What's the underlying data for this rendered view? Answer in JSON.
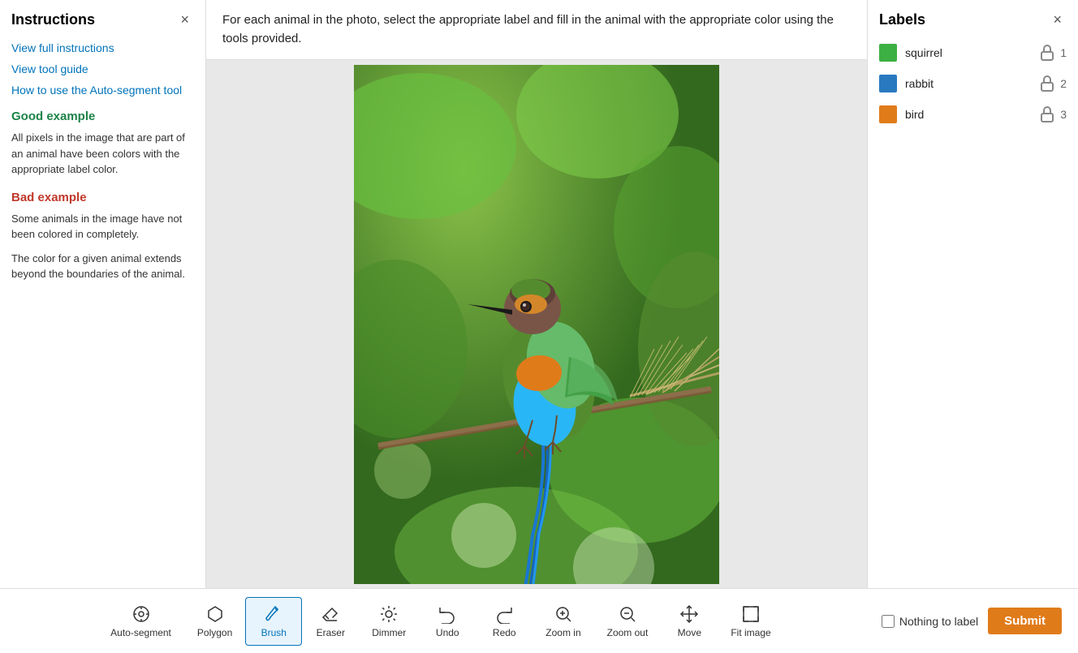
{
  "sidebar": {
    "title": "Instructions",
    "close_label": "×",
    "links": [
      {
        "id": "view-full",
        "text": "View full instructions"
      },
      {
        "id": "view-tool",
        "text": "View tool guide"
      },
      {
        "id": "auto-segment",
        "text": "How to use the Auto-segment tool"
      }
    ],
    "good_example_title": "Good example",
    "good_example_text": "All pixels in the image that are part of an animal have been colors with the appropriate label color.",
    "bad_example_title": "Bad example",
    "bad_example_text1": "Some animals in the image have not been colored in completely.",
    "bad_example_text2": "The color for a given animal extends beyond the boundaries of the animal."
  },
  "instruction_bar": {
    "text": "For each animal in the photo, select the appropriate label and fill in the animal with the appropriate color using the tools provided."
  },
  "labels_panel": {
    "title": "Labels",
    "close_label": "×",
    "items": [
      {
        "id": "squirrel",
        "name": "squirrel",
        "color": "#3cb043",
        "number": 1
      },
      {
        "id": "rabbit",
        "name": "rabbit",
        "color": "#2979c0",
        "number": 2
      },
      {
        "id": "bird",
        "name": "bird",
        "color": "#e07b1a",
        "number": 3
      }
    ]
  },
  "toolbar": {
    "tools": [
      {
        "id": "auto-segment",
        "label": "Auto-segment",
        "icon": "⊙"
      },
      {
        "id": "polygon",
        "label": "Polygon",
        "icon": "◇"
      },
      {
        "id": "brush",
        "label": "Brush",
        "icon": "✏"
      },
      {
        "id": "eraser",
        "label": "Eraser",
        "icon": "⬡"
      },
      {
        "id": "dimmer",
        "label": "Dimmer",
        "icon": "☀"
      },
      {
        "id": "undo",
        "label": "Undo",
        "icon": "↩"
      },
      {
        "id": "redo",
        "label": "Redo",
        "icon": "↪"
      },
      {
        "id": "zoom-in",
        "label": "Zoom in",
        "icon": "⊕"
      },
      {
        "id": "zoom-out",
        "label": "Zoom out",
        "icon": "⊖"
      },
      {
        "id": "move",
        "label": "Move",
        "icon": "⊕"
      },
      {
        "id": "fit-image",
        "label": "Fit image",
        "icon": "⬜"
      }
    ],
    "active_tool": "brush"
  },
  "footer": {
    "nothing_to_label_text": "Nothing to label",
    "submit_label": "Submit"
  },
  "colors": {
    "accent_blue": "#0073bb",
    "good_green": "#1d8348",
    "bad_red": "#c0392b",
    "submit_orange": "#e07b1a"
  }
}
